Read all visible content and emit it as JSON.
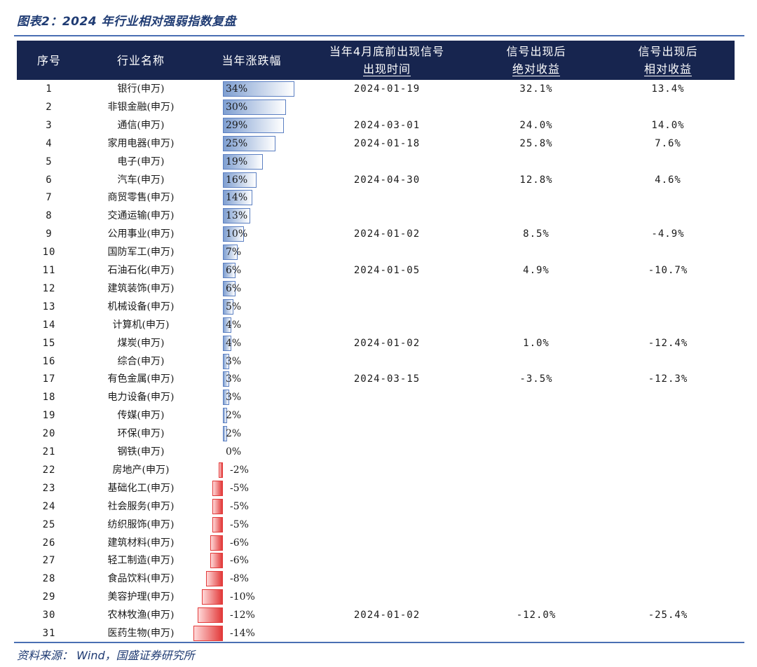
{
  "title": "图表2：2024 年行业相对强弱指数复盘",
  "source": "资料来源： Wind，国盛证券研究所",
  "colors": {
    "header_bg": "#17254f",
    "positive_bar": "#7f9fd1",
    "negative_bar": "#e23a3a",
    "accent": "#1f3b73"
  },
  "header": {
    "idx": "序号",
    "name": "行业名称",
    "change": "当年涨跌幅",
    "date_line1": "当年4月底前出现信号",
    "date_line2": "出现时间",
    "abs_line1": "信号出现后",
    "abs_line2": "绝对收益",
    "rel_line1": "信号出现后",
    "rel_line2": "相对收益"
  },
  "rows": [
    {
      "idx": "1",
      "name": "银行(申万)",
      "change": 34,
      "change_label": "34%",
      "date": "2024-01-19",
      "abs": "32.1%",
      "rel": "13.4%"
    },
    {
      "idx": "2",
      "name": "非银金融(申万)",
      "change": 30,
      "change_label": "30%",
      "date": "",
      "abs": "",
      "rel": ""
    },
    {
      "idx": "3",
      "name": "通信(申万)",
      "change": 29,
      "change_label": "29%",
      "date": "2024-03-01",
      "abs": "24.0%",
      "rel": "14.0%"
    },
    {
      "idx": "4",
      "name": "家用电器(申万)",
      "change": 25,
      "change_label": "25%",
      "date": "2024-01-18",
      "abs": "25.8%",
      "rel": "7.6%"
    },
    {
      "idx": "5",
      "name": "电子(申万)",
      "change": 19,
      "change_label": "19%",
      "date": "",
      "abs": "",
      "rel": ""
    },
    {
      "idx": "6",
      "name": "汽车(申万)",
      "change": 16,
      "change_label": "16%",
      "date": "2024-04-30",
      "abs": "12.8%",
      "rel": "4.6%"
    },
    {
      "idx": "7",
      "name": "商贸零售(申万)",
      "change": 14,
      "change_label": "14%",
      "date": "",
      "abs": "",
      "rel": ""
    },
    {
      "idx": "8",
      "name": "交通运输(申万)",
      "change": 13,
      "change_label": "13%",
      "date": "",
      "abs": "",
      "rel": ""
    },
    {
      "idx": "9",
      "name": "公用事业(申万)",
      "change": 10,
      "change_label": "10%",
      "date": "2024-01-02",
      "abs": "8.5%",
      "rel": "-4.9%"
    },
    {
      "idx": "10",
      "name": "国防军工(申万)",
      "change": 7,
      "change_label": "7%",
      "date": "",
      "abs": "",
      "rel": ""
    },
    {
      "idx": "11",
      "name": "石油石化(申万)",
      "change": 6,
      "change_label": "6%",
      "date": "2024-01-05",
      "abs": "4.9%",
      "rel": "-10.7%"
    },
    {
      "idx": "12",
      "name": "建筑装饰(申万)",
      "change": 6,
      "change_label": "6%",
      "date": "",
      "abs": "",
      "rel": ""
    },
    {
      "idx": "13",
      "name": "机械设备(申万)",
      "change": 5,
      "change_label": "5%",
      "date": "",
      "abs": "",
      "rel": ""
    },
    {
      "idx": "14",
      "name": "计算机(申万)",
      "change": 4,
      "change_label": "4%",
      "date": "",
      "abs": "",
      "rel": ""
    },
    {
      "idx": "15",
      "name": "煤炭(申万)",
      "change": 4,
      "change_label": "4%",
      "date": "2024-01-02",
      "abs": "1.0%",
      "rel": "-12.4%"
    },
    {
      "idx": "16",
      "name": "综合(申万)",
      "change": 3,
      "change_label": "3%",
      "date": "",
      "abs": "",
      "rel": ""
    },
    {
      "idx": "17",
      "name": "有色金属(申万)",
      "change": 3,
      "change_label": "3%",
      "date": "2024-03-15",
      "abs": "-3.5%",
      "rel": "-12.3%"
    },
    {
      "idx": "18",
      "name": "电力设备(申万)",
      "change": 3,
      "change_label": "3%",
      "date": "",
      "abs": "",
      "rel": ""
    },
    {
      "idx": "19",
      "name": "传媒(申万)",
      "change": 2,
      "change_label": "2%",
      "date": "",
      "abs": "",
      "rel": ""
    },
    {
      "idx": "20",
      "name": "环保(申万)",
      "change": 2,
      "change_label": "2%",
      "date": "",
      "abs": "",
      "rel": ""
    },
    {
      "idx": "21",
      "name": "钢铁(申万)",
      "change": 0,
      "change_label": "0%",
      "date": "",
      "abs": "",
      "rel": ""
    },
    {
      "idx": "22",
      "name": "房地产(申万)",
      "change": -2,
      "change_label": "-2%",
      "date": "",
      "abs": "",
      "rel": ""
    },
    {
      "idx": "23",
      "name": "基础化工(申万)",
      "change": -5,
      "change_label": "-5%",
      "date": "",
      "abs": "",
      "rel": ""
    },
    {
      "idx": "24",
      "name": "社会服务(申万)",
      "change": -5,
      "change_label": "-5%",
      "date": "",
      "abs": "",
      "rel": ""
    },
    {
      "idx": "25",
      "name": "纺织服饰(申万)",
      "change": -5,
      "change_label": "-5%",
      "date": "",
      "abs": "",
      "rel": ""
    },
    {
      "idx": "26",
      "name": "建筑材料(申万)",
      "change": -6,
      "change_label": "-6%",
      "date": "",
      "abs": "",
      "rel": ""
    },
    {
      "idx": "27",
      "name": "轻工制造(申万)",
      "change": -6,
      "change_label": "-6%",
      "date": "",
      "abs": "",
      "rel": ""
    },
    {
      "idx": "28",
      "name": "食品饮料(申万)",
      "change": -8,
      "change_label": "-8%",
      "date": "",
      "abs": "",
      "rel": ""
    },
    {
      "idx": "29",
      "name": "美容护理(申万)",
      "change": -10,
      "change_label": "-10%",
      "date": "",
      "abs": "",
      "rel": ""
    },
    {
      "idx": "30",
      "name": "农林牧渔(申万)",
      "change": -12,
      "change_label": "-12%",
      "date": "2024-01-02",
      "abs": "-12.0%",
      "rel": "-25.4%"
    },
    {
      "idx": "31",
      "name": "医药生物(申万)",
      "change": -14,
      "change_label": "-14%",
      "date": "",
      "abs": "",
      "rel": ""
    }
  ]
}
